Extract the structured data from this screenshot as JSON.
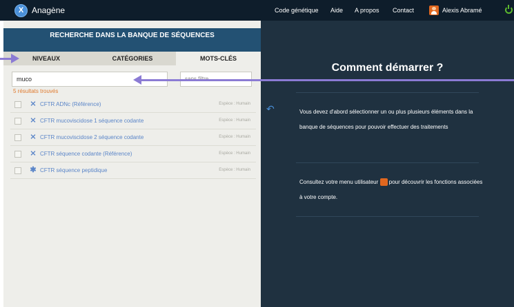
{
  "app": {
    "name": "Anagène",
    "logo_letter": "X"
  },
  "topnav": {
    "links": [
      "Code génétique",
      "Aide",
      "A propos",
      "Contact"
    ],
    "user": "Alexis Abramé"
  },
  "panel": {
    "title": "RECHERCHE DANS LA BANQUE DE SÉQUENCES",
    "tabs": [
      "NIVEAUX",
      "CATÉGORIES",
      "MOTS-CLÉS"
    ],
    "active_tab": "MOTS-CLÉS",
    "search_value": "muco",
    "filter_label": "sans filtre",
    "result_count": "5 résultats trouvés",
    "results": [
      {
        "label": "CFTR ADNc (Référence)",
        "meta": "Espèce : Humain",
        "icon": "dna-icon"
      },
      {
        "label": "CFTR mucoviscidose 1 séquence codante",
        "meta": "Espèce : Humain",
        "icon": "dna-icon"
      },
      {
        "label": "CFTR mucoviscidose 2 séquence codante",
        "meta": "Espèce : Humain",
        "icon": "dna-icon"
      },
      {
        "label": "CFTR séquence codante (Référence)",
        "meta": "Espèce : Humain",
        "icon": "dna-icon"
      },
      {
        "label": "CFTR séquence peptidique",
        "meta": "Espèce : Humain",
        "icon": "protein-icon"
      }
    ]
  },
  "help": {
    "heading": "Comment démarrer ?",
    "para1": "Vous devez d'abord sélectionner un ou plus plusieurs éléments dans la banque de séquences pour pouvoir effectuer des traitements",
    "para2_before": "Consultez votre menu utilisateur",
    "para2_after": "pour découvrir les fonctions associées à votre compte."
  },
  "colors": {
    "topbar": "#0e1d2b",
    "panel_header": "#235173",
    "right_panel": "#1f3140",
    "link_blue": "#5a85c8",
    "result_orange": "#e07a2e",
    "annotation_arrow": "#8b7bd4"
  }
}
